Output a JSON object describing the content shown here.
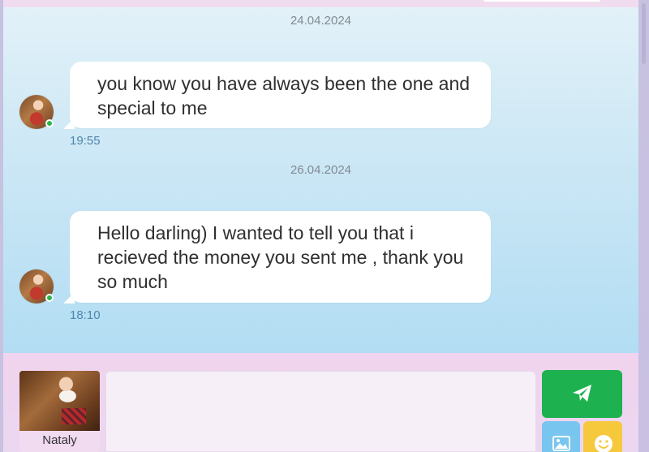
{
  "chat": {
    "messages": [
      {
        "date": "24.04.2024",
        "text": "you know you have always been the one and special to me",
        "time": "19:55"
      },
      {
        "date": "26.04.2024",
        "text": "Hello darling) I wanted to tell you that i recieved the money you sent me , thank you so much",
        "time": "18:10"
      }
    ]
  },
  "composer": {
    "profile_name": "Nataly",
    "input_value": "",
    "input_placeholder": ""
  },
  "icons": {
    "send": "paper-plane-icon",
    "photo": "image-icon",
    "emoji": "smiley-icon"
  },
  "colors": {
    "send_button": "#1eb14f",
    "photo_button": "#78c5ef",
    "emoji_button": "#f6c93d",
    "online_status": "#2ab54b",
    "time_text": "#4f86ad"
  }
}
